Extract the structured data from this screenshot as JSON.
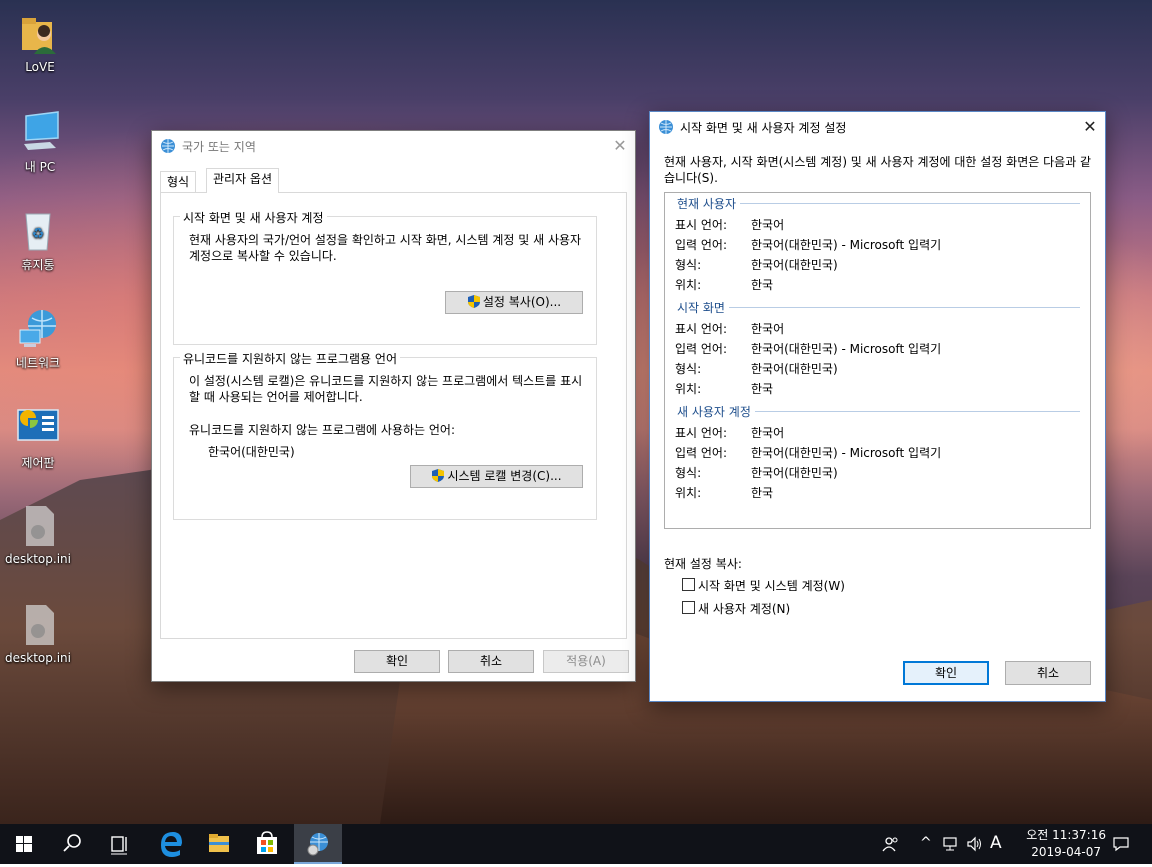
{
  "desktop": {
    "icons": [
      {
        "label": "LoVE"
      },
      {
        "label": "내 PC"
      },
      {
        "label": "휴지통"
      },
      {
        "label": "네트워크"
      },
      {
        "label": "제어판"
      },
      {
        "label": "desktop.ini"
      },
      {
        "label": "desktop.ini"
      }
    ]
  },
  "region_window": {
    "title": "국가 또는 지역",
    "close_glyph": "✕",
    "tabs": [
      "형식",
      "관리자 옵션"
    ],
    "active_tab": "관리자 옵션",
    "group1": {
      "legend": "시작 화면 및 새 사용자 계정",
      "text": "현재 사용자의 국가/언어 설정을 확인하고 시작 화면, 시스템 계정 및 새 사용자 계정으로 복사할 수 있습니다.",
      "button": "설정 복사(O)..."
    },
    "group2": {
      "legend": "유니코드를 지원하지 않는 프로그램용 언어",
      "text": "이 설정(시스템 로캘)은 유니코드를 지원하지 않는 프로그램에서 텍스트를 표시할 때 사용되는 언어를 제어합니다.",
      "current_label": "유니코드를 지원하지 않는 프로그램에 사용하는 언어:",
      "current_value": "한국어(대한민국)",
      "button": "시스템 로캘 변경(C)..."
    },
    "buttons": {
      "ok": "확인",
      "cancel": "취소",
      "apply": "적용(A)"
    }
  },
  "settings_window": {
    "title": "시작 화면 및 새 사용자 계정 설정",
    "close_glyph": "✕",
    "intro": "현재 사용자, 시작 화면(시스템 계정) 및 새 사용자 계정에 대한 설정 화면은 다음과 같습니다(S).",
    "sections": [
      {
        "heading": "현재 사용자",
        "rows": [
          {
            "label": "표시 언어:",
            "value": "한국어"
          },
          {
            "label": "입력 언어:",
            "value": "한국어(대한민국) - Microsoft 입력기"
          },
          {
            "label": "형식:",
            "value": "한국어(대한민국)"
          },
          {
            "label": "위치:",
            "value": "한국"
          }
        ]
      },
      {
        "heading": "시작 화면",
        "rows": [
          {
            "label": "표시 언어:",
            "value": "한국어"
          },
          {
            "label": "입력 언어:",
            "value": "한국어(대한민국) - Microsoft 입력기"
          },
          {
            "label": "형식:",
            "value": "한국어(대한민국)"
          },
          {
            "label": "위치:",
            "value": "한국"
          }
        ]
      },
      {
        "heading": "새 사용자 계정",
        "rows": [
          {
            "label": "표시 언어:",
            "value": "한국어"
          },
          {
            "label": "입력 언어:",
            "value": "한국어(대한민국) - Microsoft 입력기"
          },
          {
            "label": "형식:",
            "value": "한국어(대한민국)"
          },
          {
            "label": "위치:",
            "value": "한국"
          }
        ]
      }
    ],
    "copy_label": "현재 설정 복사:",
    "checkbox_welcome": {
      "label": "시작 화면 및 시스템 계정(W)",
      "checked": false
    },
    "checkbox_newuser": {
      "label": "새 사용자 계정(N)",
      "checked": false
    },
    "buttons": {
      "ok": "확인",
      "cancel": "취소"
    }
  },
  "taskbar": {
    "clock_time": "오전 11:37:16",
    "clock_date": "2019-04-07",
    "ime_indicator": "A",
    "tray_chevron": "^"
  },
  "colors": {
    "accent": "#0078d7",
    "section_heading": "#1e4e8c",
    "taskbar": "#101218"
  }
}
